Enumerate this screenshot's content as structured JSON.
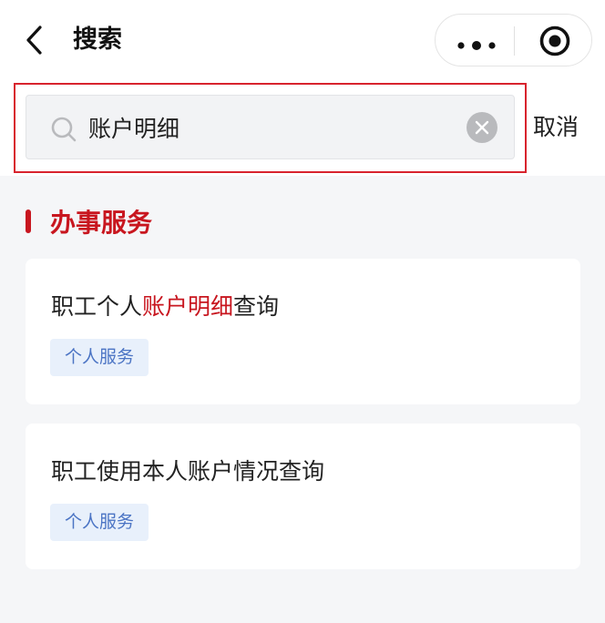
{
  "header": {
    "title": "搜索",
    "icons": {
      "back": "back-chevron-icon",
      "more": "more-dots-icon",
      "close": "target-close-icon"
    }
  },
  "search": {
    "value": "账户明细",
    "placeholder": "",
    "cancel_label": "取消",
    "icons": {
      "search": "search-icon",
      "clear": "clear-icon"
    },
    "highlight_color": "#d8232d"
  },
  "section": {
    "title": "办事服务",
    "accent_color": "#c8161f"
  },
  "results": [
    {
      "title_prefix": "职工个人",
      "title_match": "账户明细",
      "title_suffix": "查询",
      "tag": "个人服务"
    },
    {
      "title": "职工使用本人账户情况查询",
      "tag": "个人服务"
    }
  ]
}
